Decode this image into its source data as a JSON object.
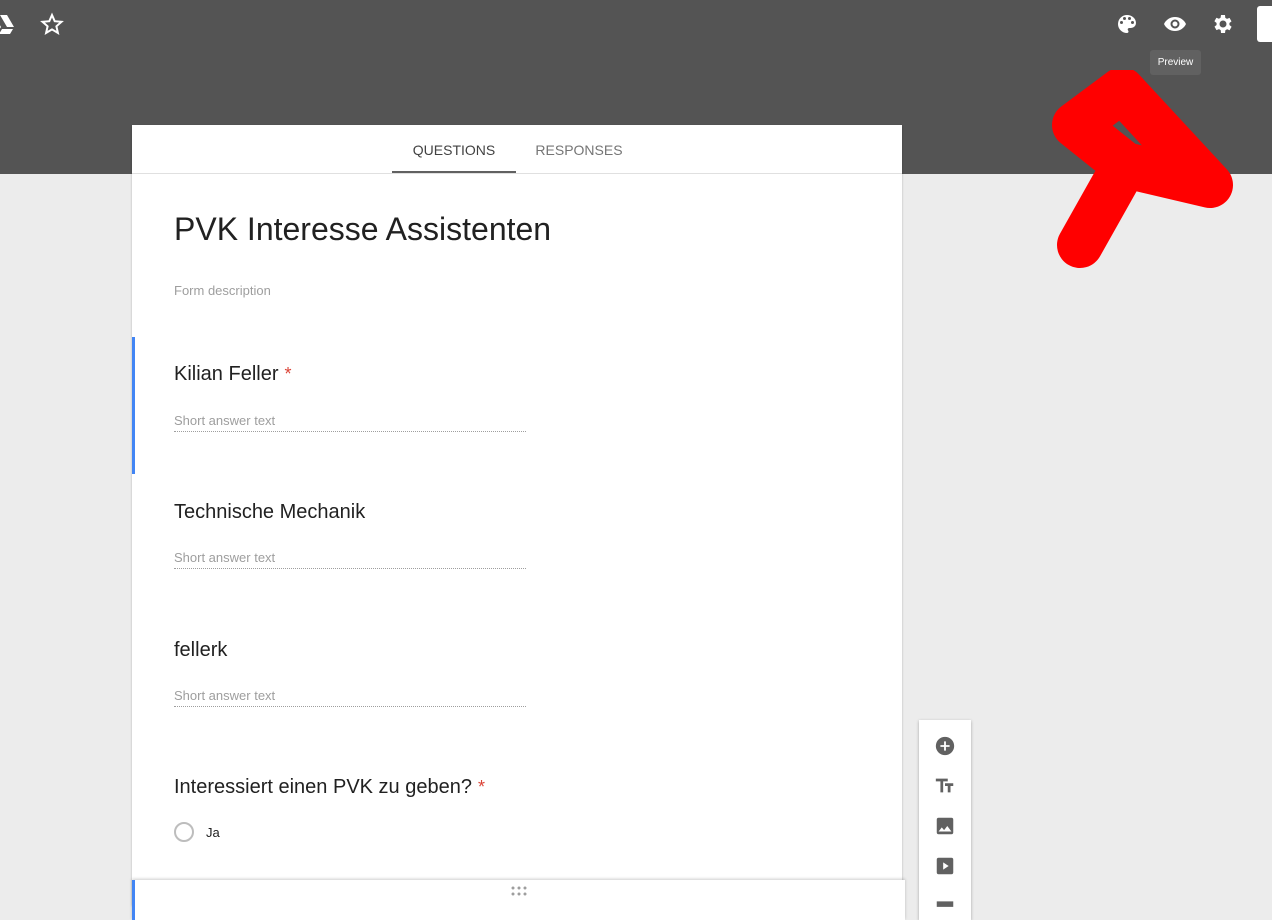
{
  "header": {
    "tooltip": "Preview",
    "icons": [
      "drive-add-icon",
      "star-icon",
      "palette-icon",
      "eye-icon",
      "gear-icon"
    ]
  },
  "tabs": [
    {
      "label": "QUESTIONS",
      "active": true
    },
    {
      "label": "RESPONSES",
      "active": false
    }
  ],
  "form": {
    "title": "PVK Interesse Assistenten",
    "description": "Form description"
  },
  "questions": [
    {
      "title": "Kilian Feller",
      "required": true,
      "placeholder": "Short answer text"
    },
    {
      "title": "Technische Mechanik",
      "required": false,
      "placeholder": "Short answer text"
    },
    {
      "title": "fellerk",
      "required": false,
      "placeholder": "Short answer text"
    },
    {
      "title": "Interessiert einen PVK zu geben?",
      "required": true,
      "options": [
        "Ja"
      ]
    }
  ],
  "required_mark": "*",
  "toolbar": [
    "add-question-icon",
    "title-icon",
    "image-icon",
    "video-icon",
    "section-icon"
  ],
  "colors": {
    "header": "#545454",
    "accent": "#4285f4",
    "required": "#db4437",
    "annotation": "#ff0000"
  }
}
